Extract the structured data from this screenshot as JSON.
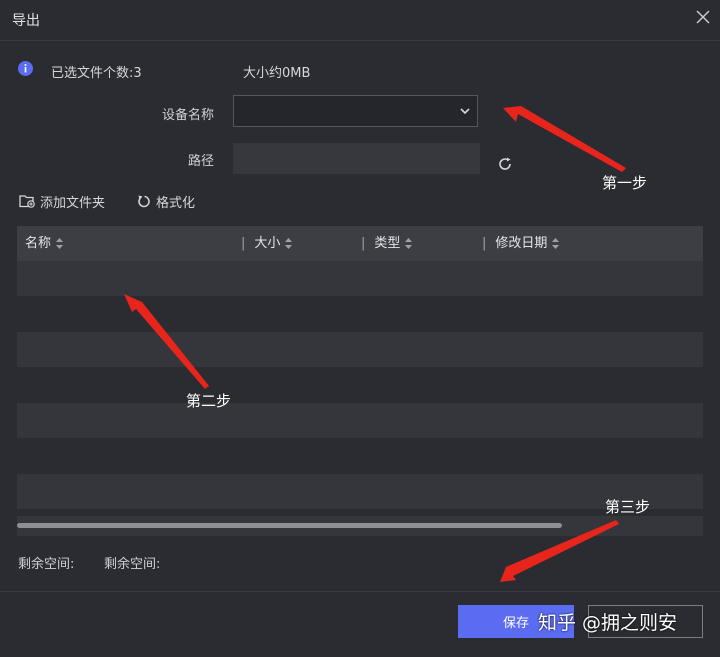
{
  "dialog": {
    "title": "导出",
    "close_icon": "close-icon"
  },
  "info": {
    "icon": "info-icon",
    "selected_files": "已选文件个数:3",
    "size": "大小约0MB"
  },
  "form": {
    "device_label": "设备名称",
    "device_value": "",
    "path_label": "路径",
    "path_value": "",
    "refresh_icon": "refresh-icon"
  },
  "toolbar": {
    "add_folder": "添加文件夹",
    "format": "格式化"
  },
  "table": {
    "columns": [
      "名称",
      "大小",
      "类型",
      "修改日期"
    ],
    "rows": []
  },
  "space": {
    "left": "剩余空间:",
    "right": "剩余空间:"
  },
  "footer": {
    "save_label": "保存",
    "cancel_label": ""
  },
  "annotations": {
    "step1": "第一步",
    "step2": "第二步",
    "step3": "第三步",
    "arrow_color": "#e8251d"
  },
  "watermark": "知乎 @拥之则安",
  "colors": {
    "background": "#2b2c31",
    "accent": "#5b6cf2",
    "info": "#5b6cf2"
  }
}
